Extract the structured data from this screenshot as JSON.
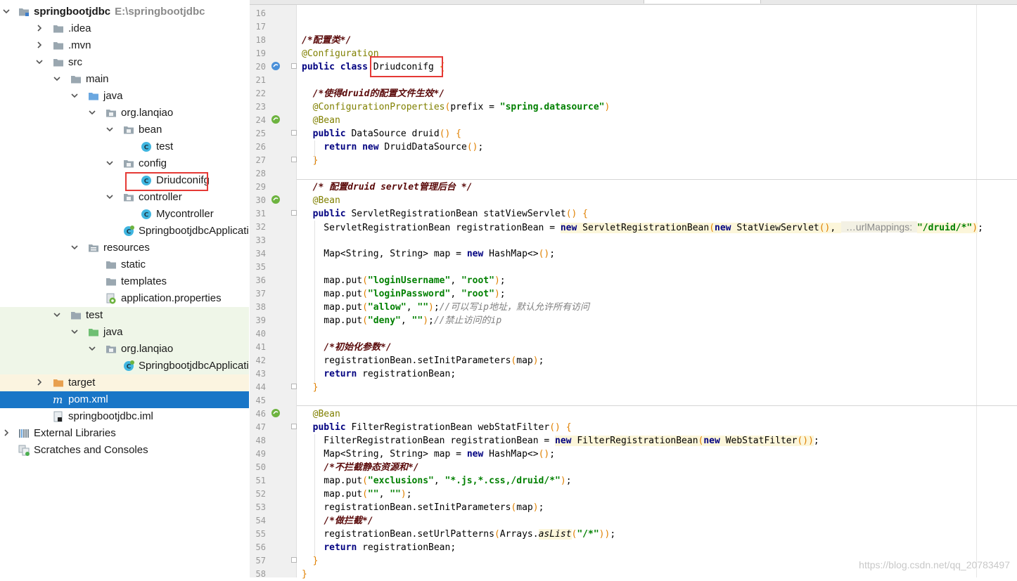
{
  "project_tree": {
    "root": {
      "name": "springbootjdbc",
      "path": "E:\\springbootjdbc"
    },
    "items": [
      {
        "label": "springbootjdbc",
        "path": "E:\\springbootjdbc",
        "icon": "module-folder-icon",
        "arrow": "down",
        "selected": false
      },
      {
        "label": ".idea",
        "icon": "folder-icon",
        "arrow": "right"
      },
      {
        "label": ".mvn",
        "icon": "folder-icon",
        "arrow": "right"
      },
      {
        "label": "src",
        "icon": "folder-icon",
        "arrow": "down"
      },
      {
        "label": "main",
        "icon": "folder-icon",
        "arrow": "down"
      },
      {
        "label": "java",
        "icon": "source-folder-icon",
        "arrow": "down"
      },
      {
        "label": "org.lanqiao",
        "icon": "package-icon",
        "arrow": "down"
      },
      {
        "label": "bean",
        "icon": "package-icon",
        "arrow": "down"
      },
      {
        "label": "test",
        "icon": "class-icon",
        "arrow": "none"
      },
      {
        "label": "config",
        "icon": "package-icon",
        "arrow": "down"
      },
      {
        "label": "Driudconifg",
        "icon": "class-icon",
        "arrow": "none"
      },
      {
        "label": "controller",
        "icon": "package-icon",
        "arrow": "down"
      },
      {
        "label": "Mycontroller",
        "icon": "class-icon",
        "arrow": "none"
      },
      {
        "label": "SpringbootjdbcApplication",
        "icon": "spring-boot-class-icon",
        "arrow": "none"
      },
      {
        "label": "resources",
        "icon": "resources-folder-icon",
        "arrow": "down"
      },
      {
        "label": "static",
        "icon": "folder-icon",
        "arrow": "none"
      },
      {
        "label": "templates",
        "icon": "folder-icon",
        "arrow": "none"
      },
      {
        "label": "application.properties",
        "icon": "spring-properties-icon",
        "arrow": "none"
      },
      {
        "label": "test",
        "icon": "folder-icon",
        "arrow": "down"
      },
      {
        "label": "java",
        "icon": "test-source-folder-icon",
        "arrow": "down"
      },
      {
        "label": "org.lanqiao",
        "icon": "package-icon",
        "arrow": "down"
      },
      {
        "label": "SpringbootjdbcApplication",
        "icon": "spring-boot-class-icon",
        "arrow": "none"
      },
      {
        "label": "target",
        "icon": "excluded-folder-icon",
        "arrow": "right"
      },
      {
        "label": "pom.xml",
        "icon": "maven-icon",
        "arrow": "none",
        "selected": true
      },
      {
        "label": "springbootjdbc.iml",
        "icon": "iml-file-icon",
        "arrow": "none"
      },
      {
        "label": "External Libraries",
        "icon": "libraries-icon",
        "arrow": "right"
      },
      {
        "label": "Scratches and Consoles",
        "icon": "scratches-icon",
        "arrow": "none"
      }
    ]
  },
  "editor": {
    "line_numbers": [
      "16",
      "17",
      "18",
      "19",
      "20",
      "21",
      "22",
      "23",
      "24",
      "25",
      "26",
      "27",
      "28",
      "29",
      "30",
      "31",
      "32",
      "33",
      "34",
      "35",
      "36",
      "37",
      "38",
      "39",
      "40",
      "41",
      "42",
      "43",
      "44",
      "45",
      "46",
      "47",
      "48",
      "49",
      "50",
      "51",
      "52",
      "53",
      "54",
      "55",
      "56",
      "57",
      "58"
    ],
    "lines": [
      [],
      [],
      [
        {
          "t": "/*配置类*/",
          "c": "cmtb"
        }
      ],
      [
        {
          "t": "@Configuration",
          "c": "ann"
        }
      ],
      [
        {
          "t": "public class ",
          "c": "kw"
        },
        {
          "t": "Driudconifg",
          "c": ""
        },
        {
          "t": " {",
          "c": "br"
        }
      ],
      [],
      [
        {
          "t": "  "
        },
        {
          "t": "/*使得",
          "c": "cmtb"
        },
        {
          "t": "druid",
          "c": "cmtb"
        },
        {
          "t": "的配置文件生效*/",
          "c": "cmtb"
        }
      ],
      [
        {
          "t": "  "
        },
        {
          "t": "@ConfigurationProperties",
          "c": "ann"
        },
        {
          "t": "(",
          "c": "br"
        },
        {
          "t": "prefix = "
        },
        {
          "t": "\"spring.datasource\"",
          "c": "str"
        },
        {
          "t": ")",
          "c": "br"
        }
      ],
      [
        {
          "t": "  "
        },
        {
          "t": "@Bean",
          "c": "ann"
        }
      ],
      [
        {
          "t": "  "
        },
        {
          "t": "public ",
          "c": "kw"
        },
        {
          "t": "DataSource druid"
        },
        {
          "t": "() {",
          "c": "br"
        }
      ],
      [
        {
          "t": "    "
        },
        {
          "t": "return new ",
          "c": "kw"
        },
        {
          "t": "DruidDataSource"
        },
        {
          "t": "()",
          "c": "br"
        },
        {
          "t": ";"
        }
      ],
      [
        {
          "t": "  "
        },
        {
          "t": "}",
          "c": "br"
        }
      ],
      [],
      [
        {
          "t": "  "
        },
        {
          "t": "/* 配置",
          "c": "cmtb"
        },
        {
          "t": "druid servlet",
          "c": "cmtb"
        },
        {
          "t": "管理后台 */",
          "c": "cmtb"
        }
      ],
      [
        {
          "t": "  "
        },
        {
          "t": "@Bean",
          "c": "ann"
        }
      ],
      [
        {
          "t": "  "
        },
        {
          "t": "public ",
          "c": "kw"
        },
        {
          "t": "ServletRegistrationBean statViewServlet"
        },
        {
          "t": "() {",
          "c": "br"
        }
      ],
      [
        {
          "t": "    ServletRegistrationBean registrationBean = "
        },
        {
          "t": "new ",
          "c": "kw hl"
        },
        {
          "t": "ServletRegistrationBean",
          "c": "hl"
        },
        {
          "t": "(",
          "c": "hl br"
        },
        {
          "t": "new ",
          "c": "kw hl"
        },
        {
          "t": "StatViewServlet",
          "c": "hl"
        },
        {
          "t": "()",
          "c": "hl br"
        },
        {
          "t": ", ",
          "c": "hl"
        },
        {
          "t": " …urlMappings: ",
          "c": "hint"
        },
        {
          "t": "\"/druid/*\"",
          "c": "str hl"
        },
        {
          "t": ")",
          "c": "hl br"
        },
        {
          "t": ";"
        }
      ],
      [],
      [
        {
          "t": "    Map<String, String> map = "
        },
        {
          "t": "new ",
          "c": "kw"
        },
        {
          "t": "HashMap<>"
        },
        {
          "t": "()",
          "c": "br"
        },
        {
          "t": ";"
        }
      ],
      [],
      [
        {
          "t": "    map.put"
        },
        {
          "t": "(",
          "c": "br"
        },
        {
          "t": "\"loginUsername\"",
          "c": "str"
        },
        {
          "t": ", "
        },
        {
          "t": "\"root\"",
          "c": "str"
        },
        {
          "t": ")",
          "c": "br"
        },
        {
          "t": ";"
        }
      ],
      [
        {
          "t": "    map.put"
        },
        {
          "t": "(",
          "c": "br"
        },
        {
          "t": "\"loginPassword\"",
          "c": "str"
        },
        {
          "t": ", "
        },
        {
          "t": "\"root\"",
          "c": "str"
        },
        {
          "t": ")",
          "c": "br"
        },
        {
          "t": ";"
        }
      ],
      [
        {
          "t": "    map.put"
        },
        {
          "t": "(",
          "c": "br"
        },
        {
          "t": "\"allow\"",
          "c": "str"
        },
        {
          "t": ", "
        },
        {
          "t": "\"\"",
          "c": "str"
        },
        {
          "t": ")",
          "c": "br"
        },
        {
          "t": ";"
        },
        {
          "t": "//可以写ip地址，默认允许所有访问",
          "c": "cmt"
        }
      ],
      [
        {
          "t": "    map.put"
        },
        {
          "t": "(",
          "c": "br"
        },
        {
          "t": "\"deny\"",
          "c": "str"
        },
        {
          "t": ", "
        },
        {
          "t": "\"\"",
          "c": "str"
        },
        {
          "t": ")",
          "c": "br"
        },
        {
          "t": ";"
        },
        {
          "t": "//禁止访问的ip",
          "c": "cmt"
        }
      ],
      [],
      [
        {
          "t": "    "
        },
        {
          "t": "/*初始化参数*/",
          "c": "cmtb"
        }
      ],
      [
        {
          "t": "    registrationBean.setInitParameters"
        },
        {
          "t": "(",
          "c": "br"
        },
        {
          "t": "map"
        },
        {
          "t": ")",
          "c": "br"
        },
        {
          "t": ";"
        }
      ],
      [
        {
          "t": "    "
        },
        {
          "t": "return ",
          "c": "kw"
        },
        {
          "t": "registrationBean;"
        }
      ],
      [
        {
          "t": "  "
        },
        {
          "t": "}",
          "c": "br"
        }
      ],
      [],
      [
        {
          "t": "  "
        },
        {
          "t": "@Bean",
          "c": "ann"
        }
      ],
      [
        {
          "t": "  "
        },
        {
          "t": "public ",
          "c": "kw"
        },
        {
          "t": "FilterRegistrationBean webStatFilter"
        },
        {
          "t": "() {",
          "c": "br"
        }
      ],
      [
        {
          "t": "    FilterRegistrationBean registrationBean = "
        },
        {
          "t": "new ",
          "c": "kw hl"
        },
        {
          "t": "FilterRegistrationBean",
          "c": "hl"
        },
        {
          "t": "(",
          "c": "hl br"
        },
        {
          "t": "new ",
          "c": "kw hl"
        },
        {
          "t": "WebStatFilter",
          "c": "hl"
        },
        {
          "t": "())",
          "c": "hl br"
        },
        {
          "t": ";"
        }
      ],
      [
        {
          "t": "    Map<String, String> map = "
        },
        {
          "t": "new ",
          "c": "kw"
        },
        {
          "t": "HashMap<>"
        },
        {
          "t": "()",
          "c": "br"
        },
        {
          "t": ";"
        }
      ],
      [
        {
          "t": "    "
        },
        {
          "t": "/*不拦截静态资源和*/",
          "c": "cmtb"
        }
      ],
      [
        {
          "t": "    map.put"
        },
        {
          "t": "(",
          "c": "br"
        },
        {
          "t": "\"exclusions\"",
          "c": "str"
        },
        {
          "t": ", "
        },
        {
          "t": "\"*.js,*.css,/druid/*\"",
          "c": "str"
        },
        {
          "t": ")",
          "c": "br"
        },
        {
          "t": ";"
        }
      ],
      [
        {
          "t": "    map.put"
        },
        {
          "t": "(",
          "c": "br"
        },
        {
          "t": "\"\"",
          "c": "str"
        },
        {
          "t": ", "
        },
        {
          "t": "\"\"",
          "c": "str"
        },
        {
          "t": ")",
          "c": "br"
        },
        {
          "t": ";"
        }
      ],
      [
        {
          "t": "    registrationBean.setInitParameters"
        },
        {
          "t": "(",
          "c": "br"
        },
        {
          "t": "map"
        },
        {
          "t": ")",
          "c": "br"
        },
        {
          "t": ";"
        }
      ],
      [
        {
          "t": "    "
        },
        {
          "t": "/*做拦截*/",
          "c": "cmtb"
        }
      ],
      [
        {
          "t": "    registrationBean.setUrlPatterns"
        },
        {
          "t": "(",
          "c": "br"
        },
        {
          "t": "Arrays."
        },
        {
          "t": "asList",
          "c": "itf hl"
        },
        {
          "t": "(",
          "c": "br"
        },
        {
          "t": "\"/*\"",
          "c": "str"
        },
        {
          "t": "))",
          "c": "br"
        },
        {
          "t": ";"
        }
      ],
      [
        {
          "t": "    "
        },
        {
          "t": "return ",
          "c": "kw"
        },
        {
          "t": "registrationBean;"
        }
      ],
      [
        {
          "t": "  "
        },
        {
          "t": "}",
          "c": "br"
        }
      ],
      [
        {
          "t": "}",
          "c": "br"
        }
      ]
    ]
  },
  "watermark": "https://blog.csdn.net/qq_20783497",
  "colors": {
    "keyword": "#000080",
    "annotation": "#808000",
    "string": "#008000",
    "comment": "#808080",
    "selection": "#1976c7",
    "highlight_box": "#e53935"
  }
}
